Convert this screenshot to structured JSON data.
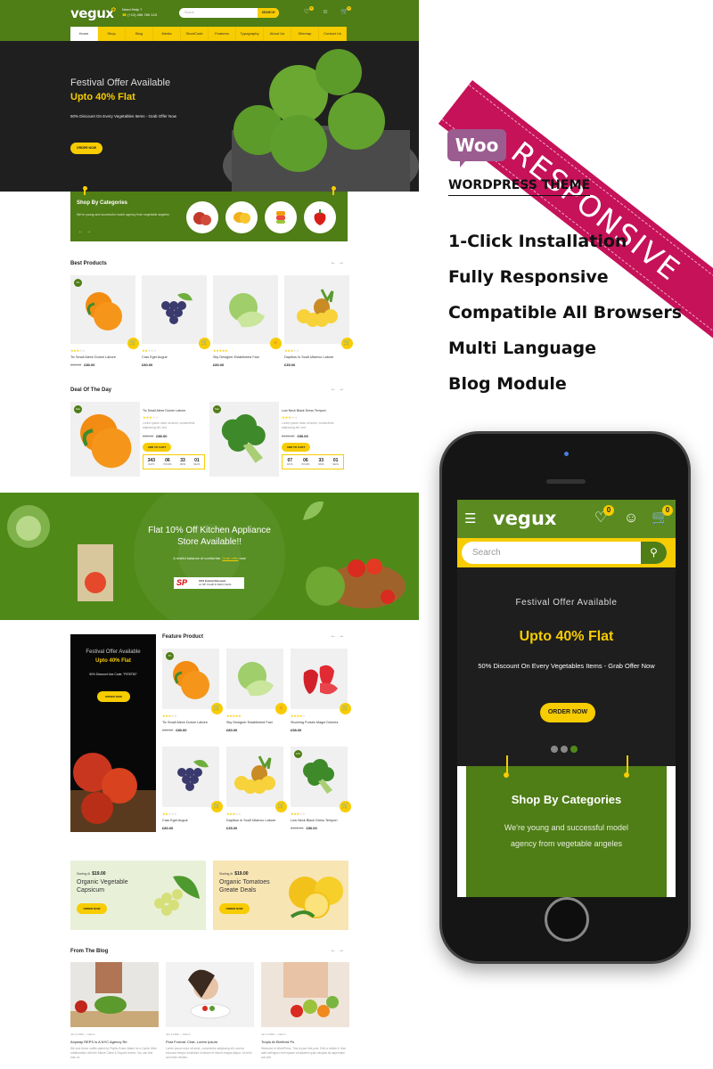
{
  "desktop": {
    "header": {
      "logo": "vegux",
      "help_label": "Need Help ?",
      "phone": "(+13) 456 789 123",
      "search_placeholder": "Search",
      "search_button": "SEARCH",
      "wishlist_count": "0",
      "cart_count": "0"
    },
    "nav": [
      "Home",
      "Shop",
      "Blog",
      "Media",
      "ShortCode",
      "Features",
      "Typography",
      "About Us",
      "Sitemap",
      "Contact Us"
    ],
    "hero": {
      "title": "Festival Offer Available",
      "highlight": "Upto 40% Flat",
      "subtitle": "50% Discount On Every Vegetables Items - Grab Offer Now",
      "button": "ORDER NOW"
    },
    "categories": {
      "title": "Shop By Categories",
      "text": "We're young and successful model agency from vegetable angeles",
      "items": [
        "apples",
        "mangoes",
        "fruit-mix",
        "capsicum"
      ]
    },
    "best_products": {
      "title": "Best Products",
      "items": [
        {
          "name": "Tic Small Alexe Dolore Labore",
          "old_price": "£85.00",
          "price": "£80.00",
          "rating": 3,
          "badge": "5%"
        },
        {
          "name": "Cras Eget Augue",
          "old_price": "",
          "price": "£80.00",
          "rating": 2,
          "badge": ""
        },
        {
          "name": "Sky Designer Established Fact",
          "old_price": "",
          "price": "£80.00",
          "rating": 5,
          "badge": ""
        },
        {
          "name": "Dapibus In Scalf Ullamco Labore",
          "old_price": "",
          "price": "£35.00",
          "rating": 3,
          "badge": ""
        }
      ]
    },
    "deal": {
      "title": "Deal Of The Day",
      "add_to_cart": "ADD TO CART",
      "desc": "Lorem ipsum dolor sit amet, consectetur adipiscing elit, sed",
      "units": [
        "DAYS",
        "HOURS",
        "MINS",
        "SECS"
      ],
      "items": [
        {
          "name": "Tic Small Alexe Dolore Labore",
          "old_price": "£85.00",
          "price": "£80.00",
          "badge": "Sale",
          "countdown": [
            "343",
            "06",
            "33",
            "01"
          ]
        },
        {
          "name": "Low Neck Black Dress Tempori",
          "old_price": "£100.00",
          "price": "£90.00",
          "badge": "Sale",
          "countdown": [
            "07",
            "06",
            "33",
            "01"
          ]
        }
      ]
    },
    "promo": {
      "title_line1": "Flat 10% Off Kitchen Appliance",
      "title_line2": "Store Available!!",
      "text": "A restful balance of comfortne.",
      "link": "Grab offer",
      "text_end": "now",
      "badge_line1": "10% Instant Discount",
      "badge_line2": "on SP Credit & Debit Cards"
    },
    "side_banner": {
      "title": "Festival Offer Available",
      "highlight": "Upto 40% Flat",
      "code": "50% Discount Use Code: \"FIRST50\"",
      "button": "ORDER NOW"
    },
    "feature_products": {
      "title": "Feature Product",
      "items": [
        {
          "name": "Tic Small Alexe Dolore Labore",
          "old_price": "£85.00",
          "price": "£80.00",
          "rating": 3,
          "badge": "5%"
        },
        {
          "name": "Sky Designer Established Fact",
          "old_price": "",
          "price": "£80.00",
          "rating": 5,
          "badge": ""
        },
        {
          "name": "Stunning Purses Magni Dolores",
          "old_price": "",
          "price": "£98.00",
          "rating": 4,
          "badge": ""
        },
        {
          "name": "Cras Eget Augue",
          "old_price": "",
          "price": "£80.00",
          "rating": 2,
          "badge": ""
        },
        {
          "name": "Dapibus In Scalf Ullamco Labore",
          "old_price": "",
          "price": "£35.00",
          "rating": 3,
          "badge": ""
        },
        {
          "name": "Low Neck Black Dress Tempori",
          "old_price": "£100.00",
          "price": "£90.00",
          "rating": 3,
          "badge": "10%"
        }
      ]
    },
    "offers": [
      {
        "starting": "Starting At",
        "price": "$19.00",
        "title": "Organic Vegetable Capsicum",
        "button": "ORDER NOW",
        "bg": "#e9f0d8"
      },
      {
        "starting": "Starting At",
        "price": "$19.00",
        "title": "Organic Tomatoes Greate Deals",
        "button": "ORDER NOW",
        "bg": "#f8e5b4"
      }
    ],
    "blog": {
      "title": "From The Blog",
      "posts": [
        {
          "date": "Jan 6,2020",
          "author": "Admin",
          "title": "Anyway REPS Is A NYC Agency Re",
          "excerpt": "We love these outfits styled by Phyllis Evans Baker for a Calvin Klein collaboration with the Maine Claire & Esquire teams. You can find mac on"
        },
        {
          "date": "Jan 3,2020",
          "author": "Admin",
          "title": "Post Format: Chat, Lorem Ipsum",
          "excerpt": "Lorem ipsum dolor sit amet, consectetur adipiscing elit, sed do eiusmod tempor incididunt ut labore et dolore magna aliqua. Ut enim ad minim veniam,"
        },
        {
          "date": "Jan 3,2020",
          "author": "Admin",
          "title": "Turpis At Eleifend Ps",
          "excerpt": "Welcome to WordPress. This is your first post. Edit or delete it, then start writingmo enim ipsam voluptatem quia voluptas sit aspernatur aut odit"
        }
      ]
    }
  },
  "marketing": {
    "ribbon": "RESPONSIVE",
    "woo": "Woo",
    "theme_label": "WORDPRESS THEME",
    "features": [
      "1-Click Installation",
      "Fully Responsive",
      "Compatible All Browsers",
      "Multi Language",
      "Blog Module"
    ]
  },
  "mobile": {
    "logo": "vegux",
    "wishlist_count": "0",
    "cart_count": "0",
    "search_placeholder": "Search",
    "hero": {
      "title": "Festival Offer Available",
      "highlight": "Upto 40% Flat",
      "subtitle": "50% Discount On Every Vegetables Items - Grab Offer Now",
      "button": "ORDER NOW",
      "active_slide": 3,
      "slides": 3
    },
    "categories": {
      "title": "Shop By Categories",
      "text": "We're young and successful model agency from vegetable angeles"
    }
  },
  "colors": {
    "brand_green": "#4f7d16",
    "accent_yellow": "#f7cc00",
    "ribbon": "#c51259",
    "woo": "#9b5c8f"
  }
}
